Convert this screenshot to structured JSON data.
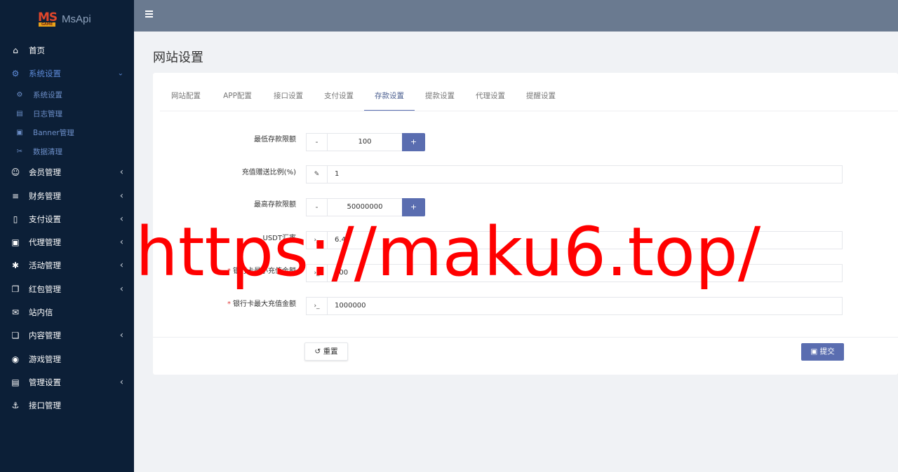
{
  "app": {
    "logo_mark": "MS",
    "logo_sub": "GAME",
    "name": "MsApi"
  },
  "sidebar": {
    "items": [
      {
        "label": "首页",
        "icon": "home-icon",
        "glyph": "⌂"
      },
      {
        "label": "系统设置",
        "icon": "cogs-icon",
        "glyph": "⚙",
        "expanded": true
      },
      {
        "label": "系统设置",
        "icon": "gear-icon",
        "glyph": "⚙",
        "sub": true
      },
      {
        "label": "日志管理",
        "icon": "file-icon",
        "glyph": "▤",
        "sub": true
      },
      {
        "label": "Banner管理",
        "icon": "image-icon",
        "glyph": "▣",
        "sub": true
      },
      {
        "label": "数据清理",
        "icon": "scissors-icon",
        "glyph": "✂",
        "sub": true
      },
      {
        "label": "会员管理",
        "icon": "user-icon",
        "glyph": "☺"
      },
      {
        "label": "财务管理",
        "icon": "database-icon",
        "glyph": "≡"
      },
      {
        "label": "支付设置",
        "icon": "bookmark-icon",
        "glyph": "▯"
      },
      {
        "label": "代理管理",
        "icon": "contact-icon",
        "glyph": "▣"
      },
      {
        "label": "活动管理",
        "icon": "activity-icon",
        "glyph": "✱"
      },
      {
        "label": "红包管理",
        "icon": "clone-icon",
        "glyph": "❐"
      },
      {
        "label": "站内信",
        "icon": "mail-icon",
        "glyph": "✉"
      },
      {
        "label": "内容管理",
        "icon": "copy-icon",
        "glyph": "❏"
      },
      {
        "label": "游戏管理",
        "icon": "gamepad-icon",
        "glyph": "◉"
      },
      {
        "label": "管理设置",
        "icon": "id-card-icon",
        "glyph": "▤"
      },
      {
        "label": "接口管理",
        "icon": "anchor-icon",
        "glyph": "⚓"
      }
    ]
  },
  "page": {
    "title": "网站设置"
  },
  "tabs": [
    "网站配置",
    "APP配置",
    "接口设置",
    "支付设置",
    "存款设置",
    "提款设置",
    "代理设置",
    "提醒设置"
  ],
  "active_tab": "存款设置",
  "form": {
    "min_deposit": {
      "label": "最低存款限额",
      "value": "100",
      "minus": "-",
      "plus": "+"
    },
    "bonus_ratio": {
      "label": "充值赠送比例(%)",
      "value": "1",
      "addon_icon": "pencil-icon"
    },
    "max_deposit": {
      "label": "最高存款限额",
      "value": "50000000",
      "minus": "-",
      "plus": "+"
    },
    "usdt_rate": {
      "label": "USDT汇率",
      "value": "6.4",
      "addon_icon": "terminal-icon"
    },
    "bank_min": {
      "label": "银行卡最小充值金额",
      "value": "100",
      "required": "*",
      "addon_icon": "terminal-icon"
    },
    "bank_max": {
      "label": "银行卡最大充值金额",
      "value": "1000000",
      "required": "*",
      "addon_icon": "terminal-icon"
    }
  },
  "buttons": {
    "reset": "重置",
    "submit": "提交"
  },
  "watermark": "https://maku6.top/"
}
